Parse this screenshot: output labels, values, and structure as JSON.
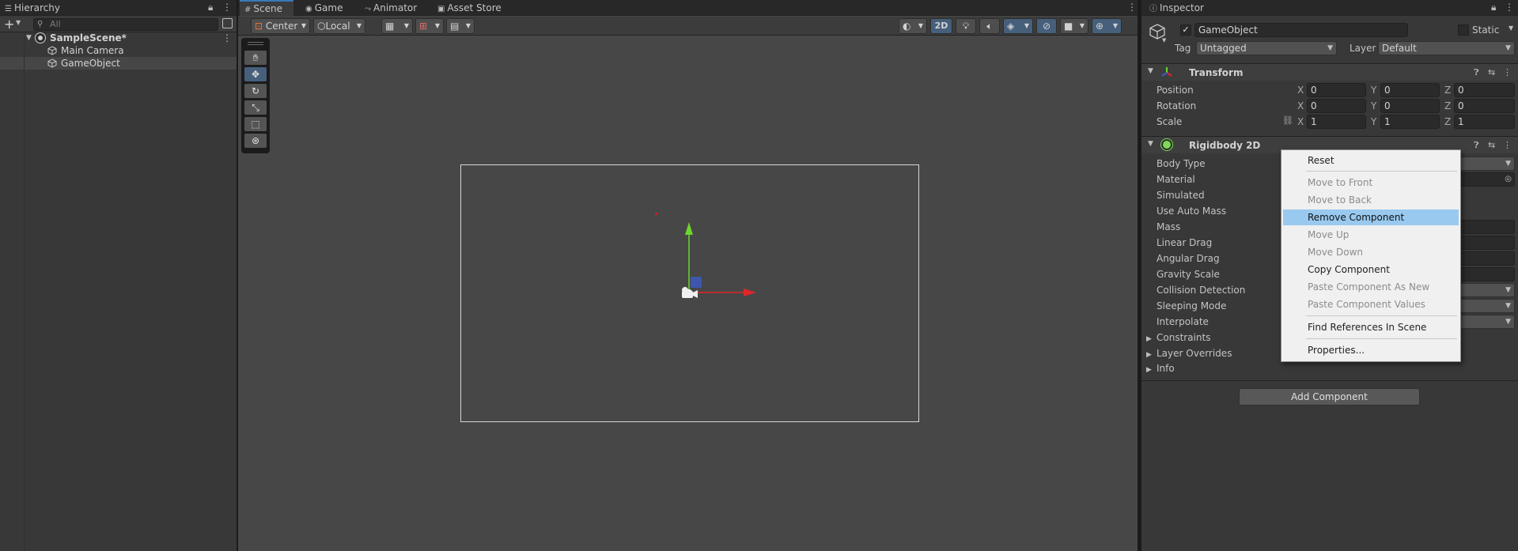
{
  "hierarchy": {
    "tab_label": "Hierarchy",
    "search_placeholder": "All",
    "items": [
      {
        "label": "SampleScene*"
      },
      {
        "label": "Main Camera"
      },
      {
        "label": "GameObject"
      }
    ]
  },
  "scene": {
    "tabs": [
      {
        "label": "Scene"
      },
      {
        "label": "Game"
      },
      {
        "label": "Animator"
      },
      {
        "label": "Asset Store"
      }
    ],
    "toolbar": {
      "pivot": "Center",
      "space": "Local",
      "mode_2d": "2D"
    }
  },
  "inspector": {
    "tab_label": "Inspector",
    "object_name": "GameObject",
    "static_label": "Static",
    "tag_label": "Tag",
    "tag_value": "Untagged",
    "layer_label": "Layer",
    "layer_value": "Default",
    "transform": {
      "title": "Transform",
      "position_label": "Position",
      "rotation_label": "Rotation",
      "scale_label": "Scale",
      "x": "X",
      "y": "Y",
      "z": "Z",
      "position": [
        "0",
        "0",
        "0"
      ],
      "rotation": [
        "0",
        "0",
        "0"
      ],
      "scale": [
        "1",
        "1",
        "1"
      ]
    },
    "rigidbody": {
      "title": "Rigidbody 2D",
      "fields": [
        {
          "label": "Body Type"
        },
        {
          "label": "Material"
        },
        {
          "label": "Simulated"
        },
        {
          "label": "Use Auto Mass"
        },
        {
          "label": "Mass"
        },
        {
          "label": "Linear Drag"
        },
        {
          "label": "Angular Drag"
        },
        {
          "label": "Gravity Scale"
        },
        {
          "label": "Collision Detection"
        },
        {
          "label": "Sleeping Mode"
        },
        {
          "label": "Interpolate"
        }
      ],
      "foldouts": [
        {
          "label": "Constraints"
        },
        {
          "label": "Layer Overrides"
        },
        {
          "label": "Info"
        }
      ]
    },
    "add_component_label": "Add Component"
  },
  "context_menu": {
    "items": [
      {
        "label": "Reset"
      },
      {
        "label": "Move to Front"
      },
      {
        "label": "Move to Back"
      },
      {
        "label": "Remove Component"
      },
      {
        "label": "Move Up"
      },
      {
        "label": "Move Down"
      },
      {
        "label": "Copy Component"
      },
      {
        "label": "Paste Component As New"
      },
      {
        "label": "Paste Component Values"
      },
      {
        "label": "Find References In Scene"
      },
      {
        "label": "Properties..."
      }
    ]
  },
  "colors": {
    "accent": "#3a79bb",
    "menu_highlight": "#99c9ef",
    "axis_x": "#e0262a",
    "axis_y": "#6cd62e",
    "axis_z": "#3a5bc7"
  }
}
